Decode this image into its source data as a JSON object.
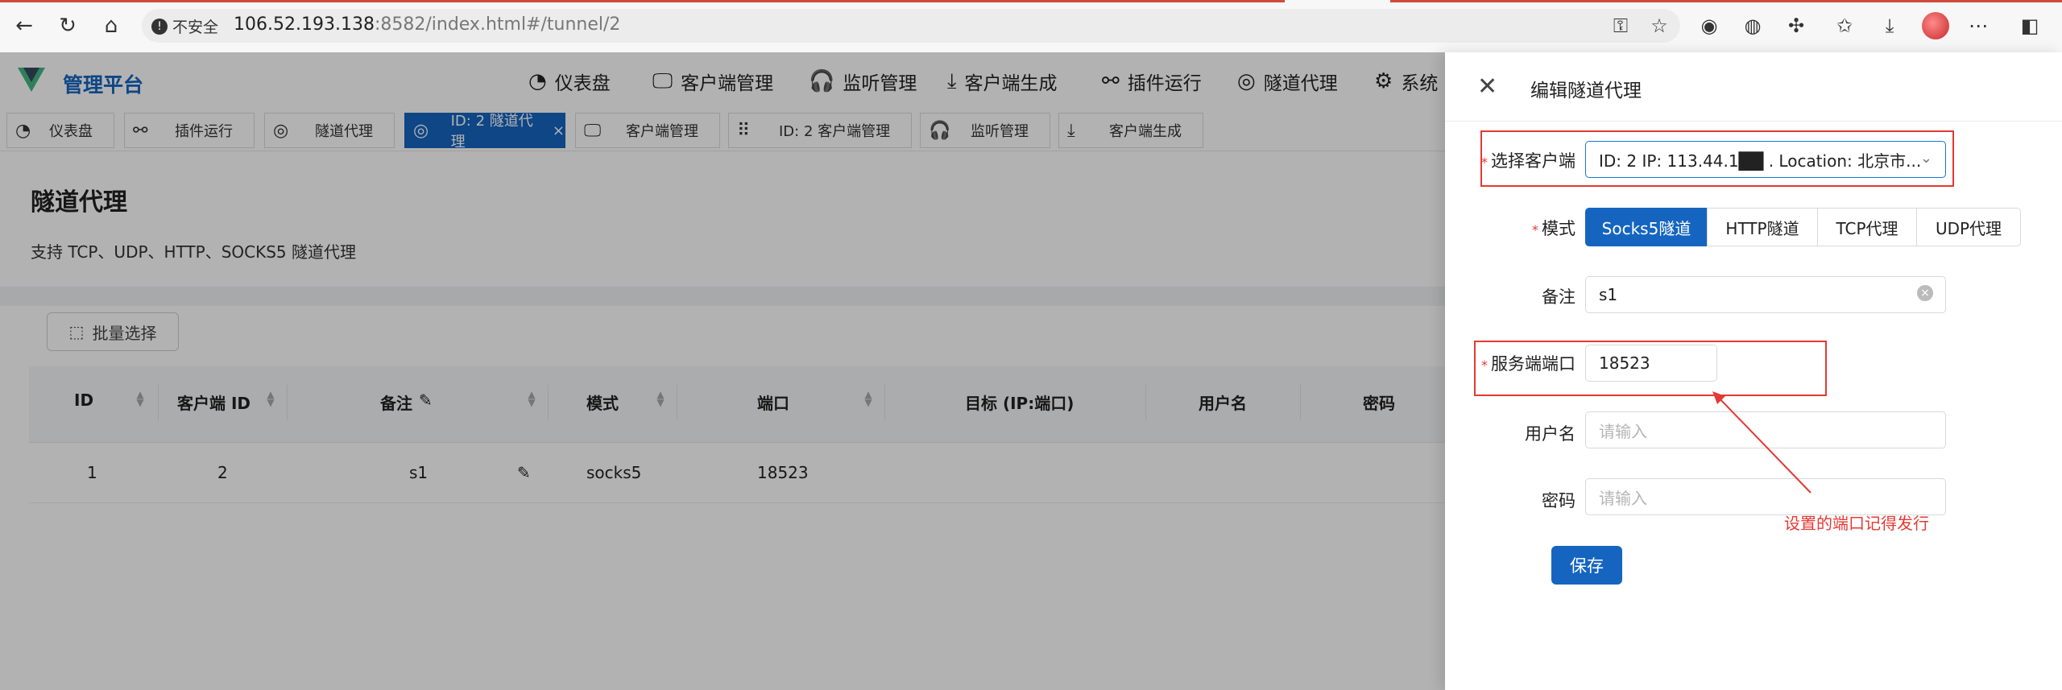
{
  "browser": {
    "security_label": "不安全",
    "url_host": "106.52.193.138",
    "url_rest": ":8582/index.html#/tunnel/2"
  },
  "app": {
    "title": "管理平台",
    "brand_color": "#1565c0",
    "nav": [
      {
        "label": "仪表盘",
        "icon": "dashboard-icon"
      },
      {
        "label": "客户端管理",
        "icon": "monitor-icon"
      },
      {
        "label": "监听管理",
        "icon": "headphones-icon"
      },
      {
        "label": "客户端生成",
        "icon": "download-icon"
      },
      {
        "label": "插件运行",
        "icon": "plugin-icon"
      },
      {
        "label": "隧道代理",
        "icon": "globe-icon"
      },
      {
        "label": "系统",
        "icon": "gear-icon"
      }
    ]
  },
  "tabs": [
    {
      "label": "仪表盘",
      "icon": "dashboard-icon"
    },
    {
      "label": "插件运行",
      "icon": "plugin-icon"
    },
    {
      "label": "隧道代理",
      "icon": "globe-icon"
    },
    {
      "label": "ID: 2 隧道代理",
      "icon": "globe-icon",
      "active": true,
      "close": "×"
    },
    {
      "label": "客户端管理",
      "icon": "monitor-icon"
    },
    {
      "label": "ID: 2 客户端管理",
      "icon": "grip-icon"
    },
    {
      "label": "监听管理",
      "icon": "headphones-icon"
    },
    {
      "label": "客户端生成",
      "icon": "download-icon"
    }
  ],
  "page": {
    "title": "隧道代理",
    "subtitle": "支持 TCP、UDP、HTTP、SOCKS5 隧道代理",
    "batch_button": "批量选择"
  },
  "table": {
    "headers": [
      "ID",
      "客户端 ID",
      "备注",
      "模式",
      "端口",
      "目标 (IP:端口)",
      "用户名",
      "密码"
    ],
    "rows": [
      {
        "id": "1",
        "client_id": "2",
        "note": "s1",
        "mode": "socks5",
        "port": "18523",
        "target": "",
        "username": "",
        "password": ""
      }
    ]
  },
  "drawer": {
    "title": "编辑隧道代理",
    "fields": {
      "client": {
        "label": "选择客户端",
        "value": "ID: 2 IP: 113.44.1██ . Location: 北京市..."
      },
      "mode": {
        "label": "模式",
        "options": [
          "Socks5隧道",
          "HTTP隧道",
          "TCP代理",
          "UDP代理"
        ],
        "selected": "Socks5隧道"
      },
      "note": {
        "label": "备注",
        "value": "s1"
      },
      "server_port": {
        "label": "服务端端口",
        "value": "18523"
      },
      "username": {
        "label": "用户名",
        "placeholder": "请输入"
      },
      "password": {
        "label": "密码",
        "placeholder": "请输入"
      }
    },
    "save_label": "保存"
  },
  "annotation": {
    "text": "设置的端口记得发行",
    "color": "#e53935"
  }
}
